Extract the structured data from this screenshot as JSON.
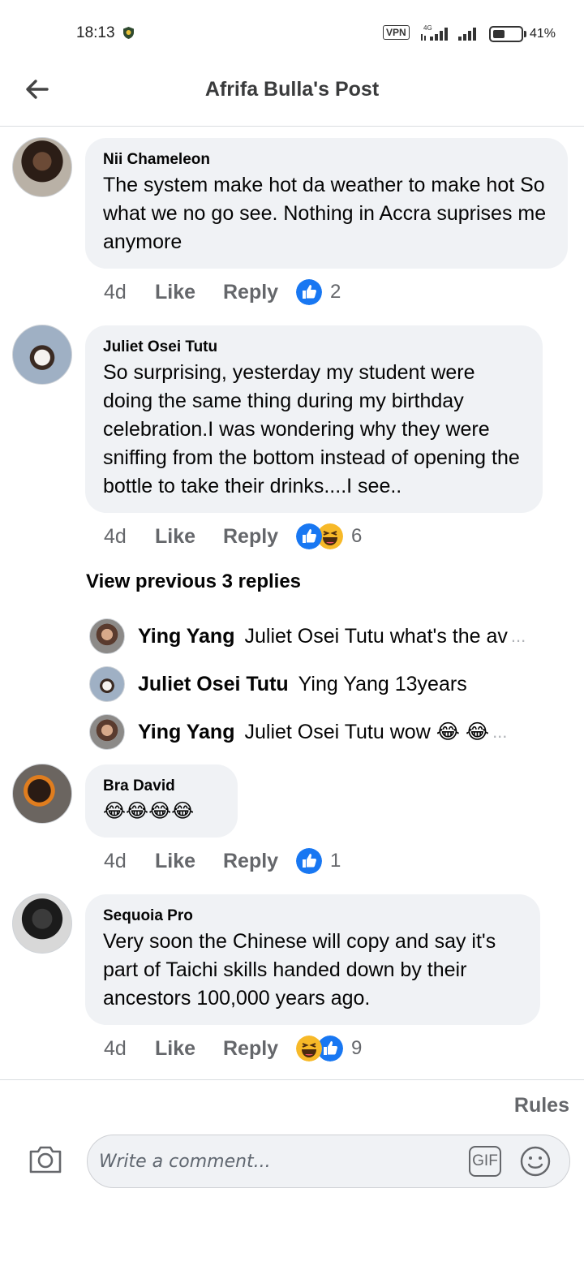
{
  "status": {
    "time": "18:13",
    "vpn": "VPN",
    "network": "4G",
    "battery": "41%"
  },
  "header": {
    "title": "Afrifa Bulla's Post"
  },
  "comments": [
    {
      "author": "Nii Chameleon",
      "text": "The system make hot da weather to make hot So what we no go see. Nothing in Accra suprises me anymore",
      "time": "4d",
      "like": "Like",
      "reply": "Reply",
      "reaction_count": "2",
      "reactions": [
        "like-icon"
      ]
    },
    {
      "author": "Juliet Osei Tutu",
      "text": "So surprising, yesterday my student were doing the same thing during my birthday celebration.I was wondering why they were sniffing from the bottom instead of opening the bottle to take their drinks....I see..",
      "time": "4d",
      "like": "Like",
      "reply": "Reply",
      "reaction_count": "6",
      "reactions": [
        "like-icon",
        "haha-icon"
      ]
    },
    {
      "author": "Bra David",
      "text": "😂😂😂😂",
      "time": "4d",
      "like": "Like",
      "reply": "Reply",
      "reaction_count": "1",
      "reactions": [
        "like-icon"
      ]
    },
    {
      "author": "Sequoia Pro",
      "text": "Very soon the Chinese will copy and say it's part of Taichi skills handed down by their ancestors 100,000 years ago.",
      "time": "4d",
      "like": "Like",
      "reply": "Reply",
      "reaction_count": "9",
      "reactions": [
        "haha-icon",
        "like-icon"
      ]
    }
  ],
  "replies": {
    "view_previous": "View previous 3 replies",
    "items": [
      {
        "name": "Ying Yang",
        "text": "Juliet Osei Tutu what's the av",
        "more": "..."
      },
      {
        "name": "Juliet Osei Tutu",
        "text": "Ying Yang 13years",
        "more": ""
      },
      {
        "name": "Ying Yang",
        "text": "Juliet Osei Tutu wow 😂 😂",
        "more": "..."
      }
    ]
  },
  "composer": {
    "rules": "Rules",
    "placeholder": "Write a comment...",
    "gif": "GIF"
  },
  "colors": {
    "bubble": "#f0f2f5",
    "like_blue": "#1877f2",
    "haha_yellow": "#f7b928",
    "meta_gray": "#65676b"
  }
}
